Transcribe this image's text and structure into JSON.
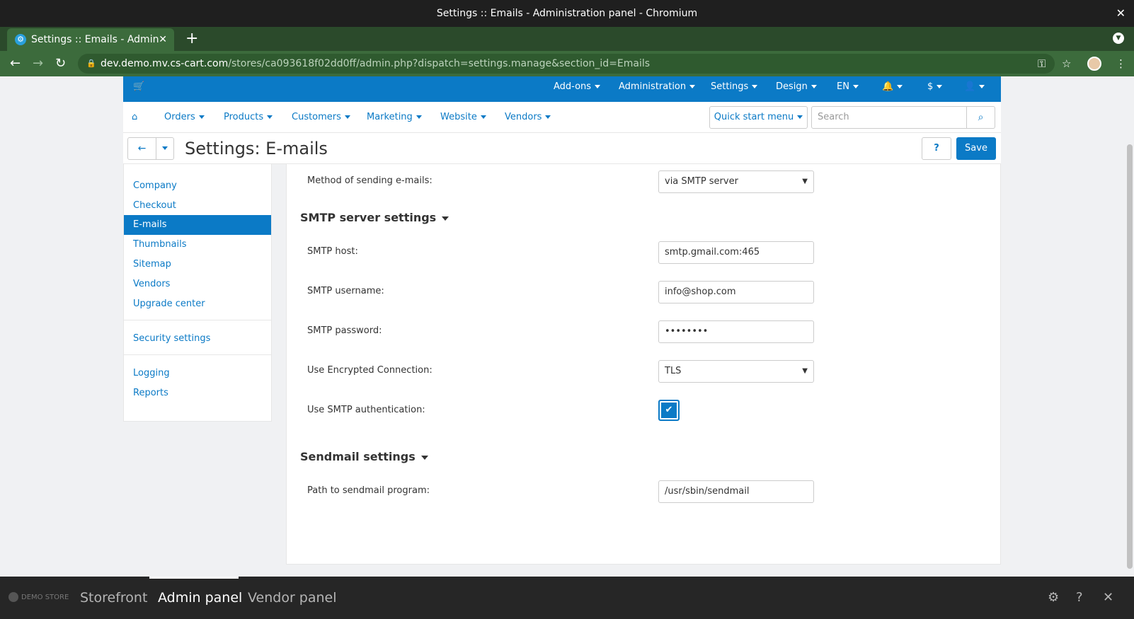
{
  "window": {
    "title": "Settings :: Emails - Administration panel - Chromium",
    "close_icon": "close-icon"
  },
  "browser": {
    "tab_title": "Settings :: Emails - Admin",
    "url_host": "dev.demo.mv.cs-cart.com",
    "url_path": "/stores/ca093618f02dd0ff/admin.php?dispatch=settings.manage&section_id=Emails"
  },
  "topnav": {
    "items": [
      "Add-ons",
      "Administration",
      "Settings",
      "Design",
      "EN",
      "$"
    ]
  },
  "mainnav": {
    "items": [
      "Orders",
      "Products",
      "Customers",
      "Marketing",
      "Website",
      "Vendors"
    ],
    "quick_start": "Quick start menu",
    "search_placeholder": "Search"
  },
  "page": {
    "title": "Settings: E-mails",
    "save_label": "Save",
    "help_label": "?"
  },
  "sidebar": {
    "group1": [
      "Company",
      "Checkout",
      "E-mails",
      "Thumbnails",
      "Sitemap",
      "Vendors",
      "Upgrade center"
    ],
    "group2": [
      "Security settings"
    ],
    "group3": [
      "Logging",
      "Reports"
    ],
    "active": "E-mails"
  },
  "form": {
    "method_label": "Method of sending e-mails:",
    "method_value": "via SMTP server",
    "smtp_section": "SMTP server settings",
    "smtp_host_label": "SMTP host:",
    "smtp_host_value": "smtp.gmail.com:465",
    "smtp_username_label": "SMTP username:",
    "smtp_username_value": "info@shop.com",
    "smtp_password_label": "SMTP password:",
    "smtp_password_value": "••••••••",
    "encryption_label": "Use Encrypted Connection:",
    "encryption_value": "TLS",
    "auth_label": "Use SMTP authentication:",
    "auth_checked": true,
    "sendmail_section": "Sendmail settings",
    "sendmail_path_label": "Path to sendmail program:",
    "sendmail_path_value": "/usr/sbin/sendmail"
  },
  "bottombar": {
    "logo_text": "DEMO STORE",
    "tabs": [
      "Storefront",
      "Admin panel",
      "Vendor panel"
    ],
    "active_tab": "Admin panel"
  },
  "colors": {
    "accent": "#0b7ac6",
    "browser_green": "#3c6b3c",
    "bottombar": "#262626"
  }
}
